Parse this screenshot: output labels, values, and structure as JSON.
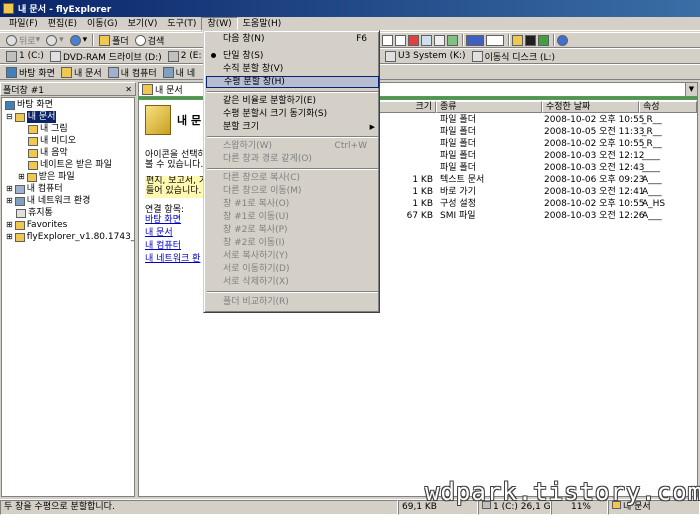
{
  "window": {
    "title": "내 문서 - flyExplorer"
  },
  "menubar": [
    "파일(F)",
    "편집(E)",
    "이동(G)",
    "보기(V)",
    "도구(T)",
    "창(W)",
    "도움말(H)"
  ],
  "toolbar": {
    "back": "뒤로",
    "folder": "폴더",
    "search": "검색"
  },
  "drivebar": [
    {
      "label": "1 (C:)"
    },
    {
      "label": "DVD-RAM 드라이브 (D:)"
    },
    {
      "label": "2 (E:"
    },
    {
      "label": "U3 System (K:)"
    },
    {
      "label": "이동식 디스크 (L:)"
    }
  ],
  "linkbar": [
    {
      "label": "바탕 화면"
    },
    {
      "label": "내 문서"
    },
    {
      "label": "내 컴퓨터"
    },
    {
      "label": "내 네"
    }
  ],
  "folder_panel": {
    "title": "폴더창 #1"
  },
  "tree": [
    {
      "label": "바탕 화면",
      "depth": 0
    },
    {
      "label": "내 문서",
      "depth": 1,
      "selected": true
    },
    {
      "label": "내 그림",
      "depth": 2
    },
    {
      "label": "내 비디오",
      "depth": 2
    },
    {
      "label": "내 음악",
      "depth": 2
    },
    {
      "label": "네이트온 받은 파일",
      "depth": 2
    },
    {
      "label": "받은 파일",
      "depth": 2
    },
    {
      "label": "내 컴퓨터",
      "depth": 1
    },
    {
      "label": "내 네트워크 환경",
      "depth": 1
    },
    {
      "label": "휴지통",
      "depth": 1
    },
    {
      "label": "Favorites",
      "depth": 1
    },
    {
      "label": "flyExplorer_v1.80.1743_port",
      "depth": 1
    }
  ],
  "address": {
    "value": "내 문서"
  },
  "task_pane": {
    "heading": "내 문",
    "desc1": "아이콘을 선택하",
    "desc2": "볼 수 있습니다.",
    "hl1": "편지, 보고서, 기",
    "hl2": "들어 있습니다. 내",
    "related": "연결 항목:",
    "links": [
      "바탕 화면",
      "내 문서",
      "내 컴퓨터",
      "내 네트워크 환"
    ]
  },
  "columns": [
    "크기",
    "종류",
    "수정한 날짜",
    "속성"
  ],
  "files": [
    {
      "size": "",
      "type": "파일 폴더",
      "date": "2008-10-02 오후 10:55",
      "attr": "_R__"
    },
    {
      "size": "",
      "type": "파일 폴더",
      "date": "2008-10-05 오전 11:33",
      "attr": "_R__"
    },
    {
      "size": "",
      "type": "파일 폴더",
      "date": "2008-10-02 오후 10:55",
      "attr": "_R__"
    },
    {
      "size": "",
      "type": "파일 폴더",
      "date": "2008-10-03 오전 12:12",
      "attr": "____"
    },
    {
      "size": "",
      "type": "파일 폴더",
      "date": "2008-10-03 오전 12:43",
      "attr": "____"
    },
    {
      "size": "1 KB",
      "type": "텍스트 문서",
      "date": "2008-10-06 오후 09:23",
      "attr": "A___"
    },
    {
      "size": "1 KB",
      "type": "바로 가기",
      "date": "2008-10-03 오전 12:41",
      "attr": "A___"
    },
    {
      "size": "1 KB",
      "type": "구성 설정",
      "date": "2008-10-02 오후 10:55",
      "attr": "A_HS"
    },
    {
      "size": "67 KB",
      "type": "SMI 파일",
      "date": "2008-10-03 오전 12:26",
      "attr": "A___"
    }
  ],
  "window_menu": [
    {
      "label": "다음 창(N)",
      "shortcut": "F6"
    },
    {
      "label": "단일 창(S)",
      "checked": true
    },
    {
      "label": "수직 분할 창(V)"
    },
    {
      "label": "수평 분할 창(H)",
      "highlighted": true
    },
    {
      "separator": true
    },
    {
      "label": "같은 비율로 분할하기(E)"
    },
    {
      "label": "수평 분할시 크기 동기화(S)"
    },
    {
      "label": "분할 크기",
      "submenu": true
    },
    {
      "separator": true
    },
    {
      "label": "스왑하기(W)",
      "shortcut": "Ctrl+W",
      "disabled": true
    },
    {
      "label": "다른 창과 경로 같게(O)",
      "disabled": true
    },
    {
      "separator": true
    },
    {
      "label": "다른 창으로 복사(C)",
      "disabled": true
    },
    {
      "label": "다른 창으로 이동(M)",
      "disabled": true
    },
    {
      "label": "창 #1로 복사(O)",
      "disabled": true
    },
    {
      "label": "창 #1로 이동(U)",
      "disabled": true
    },
    {
      "label": "창 #2로 복사(P)",
      "disabled": true
    },
    {
      "label": "창 #2로 이동(I)",
      "disabled": true
    },
    {
      "label": "서로 복사하기(Y)",
      "disabled": true
    },
    {
      "label": "서로 이동하기(D)",
      "disabled": true
    },
    {
      "label": "서로 삭제하기(X)",
      "disabled": true
    },
    {
      "separator": true
    },
    {
      "label": "폴더 비교하기(R)",
      "disabled": true
    }
  ],
  "status": [
    "두 창을 수평으로 분할합니다.",
    "69,1 KB",
    "1 (C:) 26,1 GB",
    "11%",
    "내 문서"
  ],
  "watermark": "wdpark.tistory.com"
}
